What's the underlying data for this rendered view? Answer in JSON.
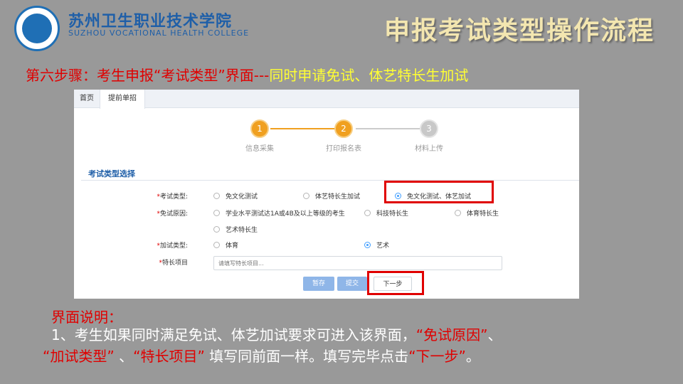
{
  "header": {
    "logo_cn": "苏州卫生职业技术学院",
    "logo_en": "SUZHOU VOCATIONAL HEALTH COLLEGE",
    "deck_title": "申报考试类型操作流程"
  },
  "step_heading": {
    "red_part": "第六步骤：考生申报“考试类型”界面---",
    "yellow_part": "同时申请免试、体艺特长生加试"
  },
  "tabs": [
    {
      "label": "首页",
      "active": false
    },
    {
      "label": "提前单招",
      "active": true
    }
  ],
  "stepper": [
    {
      "number": "1",
      "label": "信息采集",
      "state": "done"
    },
    {
      "number": "2",
      "label": "打印报名表",
      "state": "done"
    },
    {
      "number": "3",
      "label": "材料上传",
      "state": "todo"
    }
  ],
  "section_title": "考试类型选择",
  "form": {
    "exam_type": {
      "label": "考试类型:",
      "options": [
        {
          "label": "免文化测试",
          "selected": false
        },
        {
          "label": "体艺特长生加试",
          "selected": false
        },
        {
          "label": "免文化测试、体艺加试",
          "selected": true
        }
      ]
    },
    "exempt_reason": {
      "label": "免试原因:",
      "options": [
        {
          "label": "学业水平测试达1A或4B及以上等级的考生",
          "selected": false
        },
        {
          "label": "科技特长生",
          "selected": false
        },
        {
          "label": "体育特长生",
          "selected": false
        },
        {
          "label": "艺术特长生",
          "selected": false
        }
      ]
    },
    "extra_test_type": {
      "label": "加试类型:",
      "options": [
        {
          "label": "体育",
          "selected": false
        },
        {
          "label": "艺术",
          "selected": true
        }
      ]
    },
    "specialty_item": {
      "label": "特长项目",
      "value": "",
      "placeholder": "请填写特长项目..."
    }
  },
  "buttons": {
    "save": "暂存",
    "submit": "提交",
    "next": "下一步"
  },
  "notes": {
    "title": "界面说明：",
    "line1_a": "1、考生如果同时满足免试、体艺加试要求可进入该界面，",
    "line1_b": "“免试原因”",
    "line1_c": "、",
    "line2_a": "“加试类型”",
    "line2_b": " 、",
    "line2_c": "“特长项目”",
    "line2_d": " 填写同前面一样。填写完毕点击",
    "line2_e": "“下一步”",
    "line2_f": "。"
  },
  "colors": {
    "slide_bg": "#999999",
    "brand_blue": "#1f5fa8",
    "highlight_red": "#e00000",
    "step_done": "#f0a020",
    "button_blue": "#8fb6e8"
  }
}
